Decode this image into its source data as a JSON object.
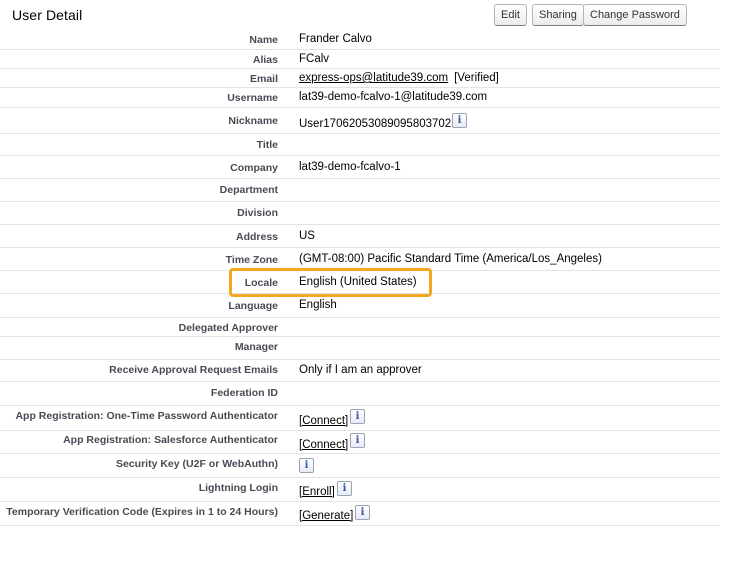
{
  "header": {
    "title": "User Detail",
    "buttons": {
      "edit": "Edit",
      "sharing": "Sharing",
      "change_password": "Change Password"
    }
  },
  "fields": {
    "name": {
      "label": "Name",
      "value": "Frander Calvo"
    },
    "alias": {
      "label": "Alias",
      "value": "FCalv"
    },
    "email": {
      "label": "Email",
      "value": "express-ops@latitude39.com",
      "suffix": "[Verified]"
    },
    "username": {
      "label": "Username",
      "value": "lat39-demo-fcalvo-1@latitude39.com"
    },
    "nickname": {
      "label": "Nickname",
      "value": "User17062053089095803702"
    },
    "title": {
      "label": "Title",
      "value": ""
    },
    "company": {
      "label": "Company",
      "value": "lat39-demo-fcalvo-1"
    },
    "department": {
      "label": "Department",
      "value": ""
    },
    "division": {
      "label": "Division",
      "value": ""
    },
    "address": {
      "label": "Address",
      "value": "US"
    },
    "time_zone": {
      "label": "Time Zone",
      "value": "(GMT-08:00) Pacific Standard Time (America/Los_Angeles)"
    },
    "locale": {
      "label": "Locale",
      "value": "English (United States)"
    },
    "language": {
      "label": "Language",
      "value": "English"
    },
    "delegated_approver": {
      "label": "Delegated Approver",
      "value": ""
    },
    "manager": {
      "label": "Manager",
      "value": ""
    },
    "receive_approval": {
      "label": "Receive Approval Request Emails",
      "value": "Only if I am an approver"
    },
    "federation_id": {
      "label": "Federation ID",
      "value": ""
    },
    "app_reg_otp": {
      "label": "App Registration: One-Time Password Authenticator",
      "link": "[Connect]"
    },
    "app_reg_sf": {
      "label": "App Registration: Salesforce Authenticator",
      "link": "[Connect]"
    },
    "security_key": {
      "label": "Security Key (U2F or WebAuthn)"
    },
    "lightning_login": {
      "label": "Lightning Login",
      "link": "[Enroll]"
    },
    "temp_code": {
      "label": "Temporary Verification Code (Expires in 1 to 24 Hours)",
      "link": "[Generate]"
    }
  },
  "icons": {
    "info": "info-icon"
  },
  "colors": {
    "highlight": "#f5a623",
    "label_text": "#4a4a56",
    "divider": "#e3e3e3"
  }
}
